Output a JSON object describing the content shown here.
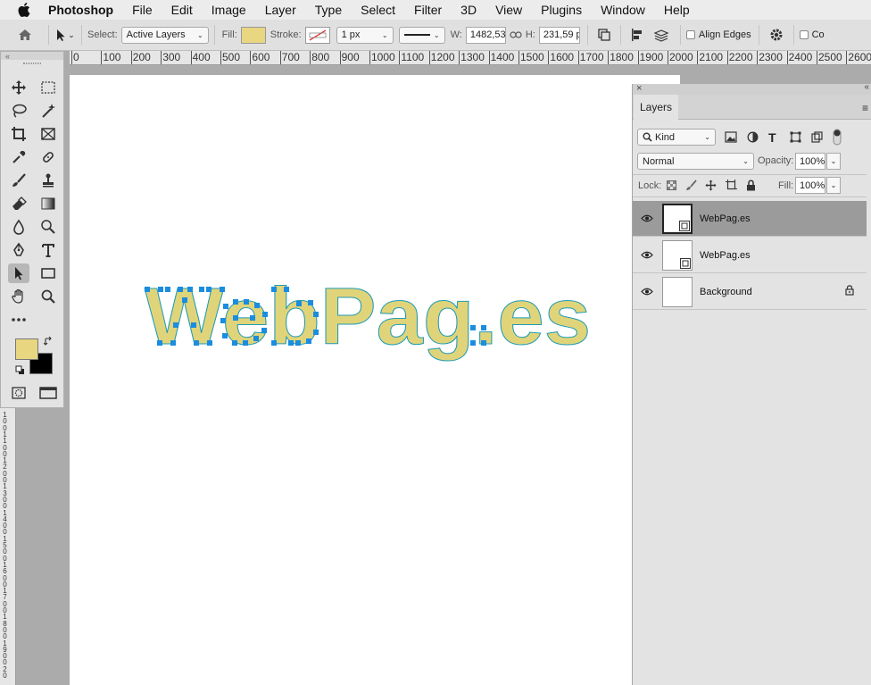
{
  "menubar": {
    "app": "Photoshop",
    "items": [
      "File",
      "Edit",
      "Image",
      "Layer",
      "Type",
      "Select",
      "Filter",
      "3D",
      "View",
      "Plugins",
      "Window",
      "Help"
    ]
  },
  "options": {
    "select_label": "Select:",
    "select_value": "Active Layers",
    "fill_label": "Fill:",
    "stroke_label": "Stroke:",
    "stroke_width": "1 px",
    "w_label": "W:",
    "w_value": "1482,53",
    "h_label": "H:",
    "h_value": "231,59 p",
    "align_edges": "Align Edges",
    "constrain_cut": "Co"
  },
  "colors": {
    "fill": "#e8d680",
    "fg": "#e8d680",
    "bg": "#000000",
    "text_fill": "#e0d47a",
    "outline": "#1f9bb5",
    "anchor": "#1a8de0"
  },
  "ruler_top": [
    "0",
    "100",
    "200",
    "300",
    "400",
    "500",
    "600",
    "700",
    "800",
    "900",
    "1000",
    "1100",
    "1200",
    "1300",
    "1400",
    "1500",
    "1600",
    "1700",
    "1800",
    "1900",
    "2000",
    "2100",
    "2200",
    "2300",
    "2400",
    "2500",
    "2600"
  ],
  "ruler_left": [
    "1",
    "2",
    "3",
    "4",
    "5",
    "6",
    "7",
    "8",
    "9",
    "1",
    "0"
  ],
  "canvas_text": "WebPag.es",
  "layers": {
    "tab": "Layers",
    "kind": "Kind",
    "blend_mode": "Normal",
    "opacity_label": "Opacity:",
    "opacity": "100%",
    "lock_label": "Lock:",
    "fill_label": "Fill:",
    "fill": "100%",
    "rows": [
      {
        "name": "WebPag.es"
      },
      {
        "name": "WebPag.es"
      },
      {
        "name": "Background"
      }
    ]
  }
}
